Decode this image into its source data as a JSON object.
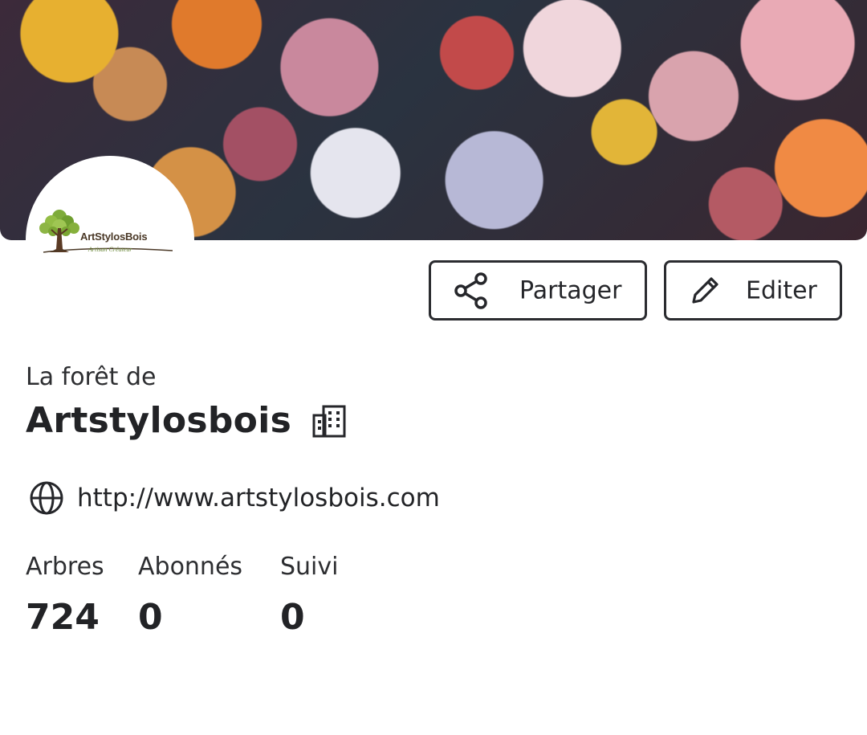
{
  "profile": {
    "logo_text": "ArtStylosBois",
    "logo_subtext": "Artisan Créateur",
    "subtitle": "La forêt de",
    "name": "Artstylosbois",
    "website": "http://www.artstylosbois.com"
  },
  "actions": {
    "share_label": "Partager",
    "edit_label": "Editer"
  },
  "stats": [
    {
      "label": "Arbres",
      "value": "724"
    },
    {
      "label": "Abonnés",
      "value": "0"
    },
    {
      "label": "Suivi",
      "value": "0"
    }
  ],
  "icons": {
    "share": "share-icon",
    "edit": "pencil-icon",
    "organization": "building-icon",
    "website": "globe-icon"
  },
  "colors": {
    "text": "#222326",
    "border": "#2b2c30",
    "background": "#ffffff"
  }
}
